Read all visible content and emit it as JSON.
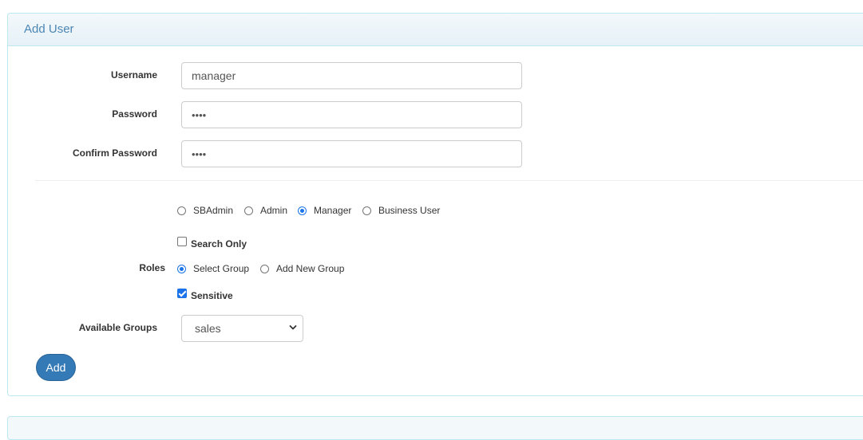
{
  "panel": {
    "title": "Add User"
  },
  "form": {
    "username": {
      "label": "Username",
      "value": "manager"
    },
    "password": {
      "label": "Password",
      "value": "••••"
    },
    "confirm_password": {
      "label": "Confirm Password",
      "value": "••••"
    }
  },
  "user_types": [
    {
      "label": "SBAdmin",
      "checked": false
    },
    {
      "label": "Admin",
      "checked": false
    },
    {
      "label": "Manager",
      "checked": true
    },
    {
      "label": "Business User",
      "checked": false
    }
  ],
  "roles": {
    "label": "Roles",
    "search_only": {
      "label": "Search Only",
      "checked": false
    },
    "group_mode": [
      {
        "label": "Select Group",
        "checked": true
      },
      {
        "label": "Add New Group",
        "checked": false
      }
    ],
    "sensitive": {
      "label": "Sensitive",
      "checked": true
    }
  },
  "available_groups": {
    "label": "Available Groups",
    "selected": "sales"
  },
  "actions": {
    "add_label": "Add"
  },
  "colors": {
    "accent": "#337ab7",
    "panel_border": "#bce8f1",
    "title": "#4b86b4"
  },
  "icons": {
    "select_arrow": "chevron-down-icon"
  }
}
